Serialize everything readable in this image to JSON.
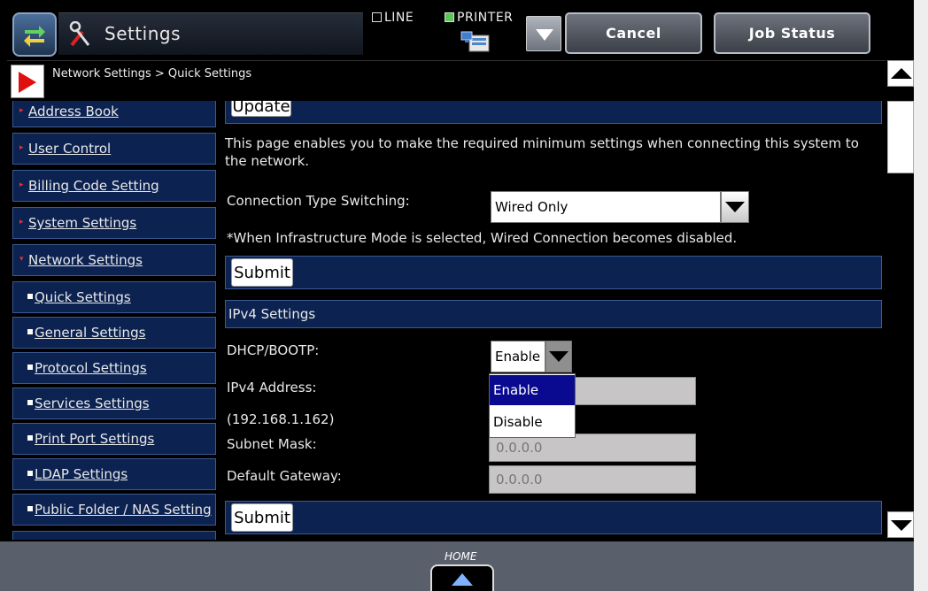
{
  "header": {
    "title": "Settings",
    "mode_line": "LINE",
    "mode_printer": "PRINTER",
    "cancel_label": "Cancel",
    "job_status_label": "Job Status"
  },
  "breadcrumb": "Network Settings > Quick Settings",
  "sidebar": {
    "items": [
      {
        "label": "Address Book",
        "sub": false
      },
      {
        "label": "User Control",
        "sub": false
      },
      {
        "label": "Billing Code Setting",
        "sub": false
      },
      {
        "label": "System Settings",
        "sub": false
      },
      {
        "label": "Network Settings",
        "sub": false,
        "expanded": true
      },
      {
        "label": "Quick Settings",
        "sub": true
      },
      {
        "label": "General Settings",
        "sub": true
      },
      {
        "label": "Protocol Settings",
        "sub": true
      },
      {
        "label": "Services Settings",
        "sub": true
      },
      {
        "label": "Print Port Settings",
        "sub": true
      },
      {
        "label": "LDAP Settings",
        "sub": true
      },
      {
        "label": "Public Folder / NAS Setting",
        "sub": true
      }
    ]
  },
  "main": {
    "update_label": "Update",
    "description": "This page enables you to make the required minimum settings when connecting this system to the network.",
    "connection_label": "Connection Type Switching:",
    "connection_value": "Wired Only",
    "infra_note": "*When Infrastructure Mode is selected, Wired Connection becomes disabled.",
    "submit_label": "Submit",
    "ipv4_heading": "IPv4 Settings",
    "dhcp_label": "DHCP/BOOTP:",
    "dhcp_value": "Enable",
    "dhcp_options": [
      "Enable",
      "Disable"
    ],
    "ipv4_label": "IPv4 Address:",
    "ipv4_current": "(192.168.1.162)",
    "subnet_label": "Subnet Mask:",
    "subnet_value": "0.0.0.0",
    "gateway_label": "Default Gateway:",
    "gateway_value": "0.0.0.0",
    "submit2_label": "Submit"
  },
  "footer": {
    "home_label": "HOME"
  },
  "colors": {
    "nav_blue": "#0c2250",
    "selected_option": "#0a0a90",
    "crumb_arrow": "#e01010"
  }
}
